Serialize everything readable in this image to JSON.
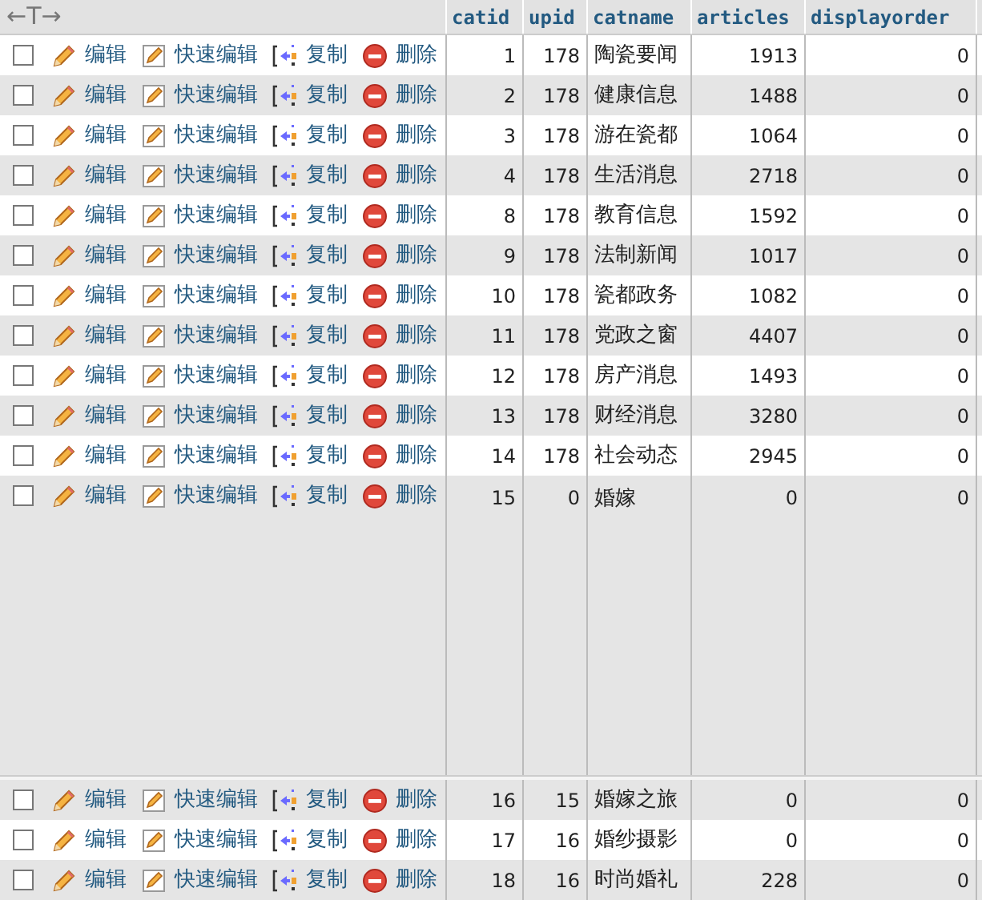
{
  "header": {
    "nav": "←T→",
    "columns": [
      "catid",
      "upid",
      "catname",
      "articles",
      "displayorder"
    ]
  },
  "rows": [
    {
      "checked": false,
      "actions": [
        "编辑",
        "快速编辑",
        "复制",
        "删除"
      ],
      "cells": [
        "1",
        "178",
        "陶瓷要闻",
        "1913",
        "0"
      ]
    },
    {
      "checked": false,
      "actions": [
        "编辑",
        "快速编辑",
        "复制",
        "删除"
      ],
      "cells": [
        "2",
        "178",
        "健康信息",
        "1488",
        "0"
      ]
    },
    {
      "checked": false,
      "actions": [
        "编辑",
        "快速编辑",
        "复制",
        "删除"
      ],
      "cells": [
        "3",
        "178",
        "游在瓷都",
        "1064",
        "0"
      ]
    },
    {
      "checked": false,
      "actions": [
        "编辑",
        "快速编辑",
        "复制",
        "删除"
      ],
      "cells": [
        "4",
        "178",
        "生活消息",
        "2718",
        "0"
      ]
    },
    {
      "checked": false,
      "actions": [
        "编辑",
        "快速编辑",
        "复制",
        "删除"
      ],
      "cells": [
        "8",
        "178",
        "教育信息",
        "1592",
        "0"
      ]
    },
    {
      "checked": false,
      "actions": [
        "编辑",
        "快速编辑",
        "复制",
        "删除"
      ],
      "cells": [
        "9",
        "178",
        "法制新闻",
        "1017",
        "0"
      ]
    },
    {
      "checked": false,
      "actions": [
        "编辑",
        "快速编辑",
        "复制",
        "删除"
      ],
      "cells": [
        "10",
        "178",
        "瓷都政务",
        "1082",
        "0"
      ]
    },
    {
      "checked": false,
      "actions": [
        "编辑",
        "快速编辑",
        "复制",
        "删除"
      ],
      "cells": [
        "11",
        "178",
        "党政之窗",
        "4407",
        "0"
      ]
    },
    {
      "checked": false,
      "actions": [
        "编辑",
        "快速编辑",
        "复制",
        "删除"
      ],
      "cells": [
        "12",
        "178",
        "房产消息",
        "1493",
        "0"
      ]
    },
    {
      "checked": false,
      "actions": [
        "编辑",
        "快速编辑",
        "复制",
        "删除"
      ],
      "cells": [
        "13",
        "178",
        "财经消息",
        "3280",
        "0"
      ]
    },
    {
      "checked": false,
      "actions": [
        "编辑",
        "快速编辑",
        "复制",
        "删除"
      ],
      "cells": [
        "14",
        "178",
        "社会动态",
        "2945",
        "0"
      ]
    },
    {
      "checked": false,
      "actions": [
        "编辑",
        "快速编辑",
        "复制",
        "删除"
      ],
      "cells": [
        "15",
        "0",
        "婚嫁",
        "0",
        "0"
      ]
    }
  ],
  "bottom_rows": [
    {
      "checked": false,
      "actions": [
        "编辑",
        "快速编辑",
        "复制",
        "删除"
      ],
      "cells": [
        "16",
        "15",
        "婚嫁之旅",
        "0",
        "0"
      ]
    },
    {
      "checked": false,
      "actions": [
        "编辑",
        "快速编辑",
        "复制",
        "删除"
      ],
      "cells": [
        "17",
        "16",
        "婚纱摄影",
        "0",
        "0"
      ]
    },
    {
      "checked": false,
      "actions": [
        "编辑",
        "快速编辑",
        "复制",
        "删除"
      ],
      "cells": [
        "18",
        "16",
        "时尚婚礼",
        "228",
        "0"
      ]
    }
  ]
}
